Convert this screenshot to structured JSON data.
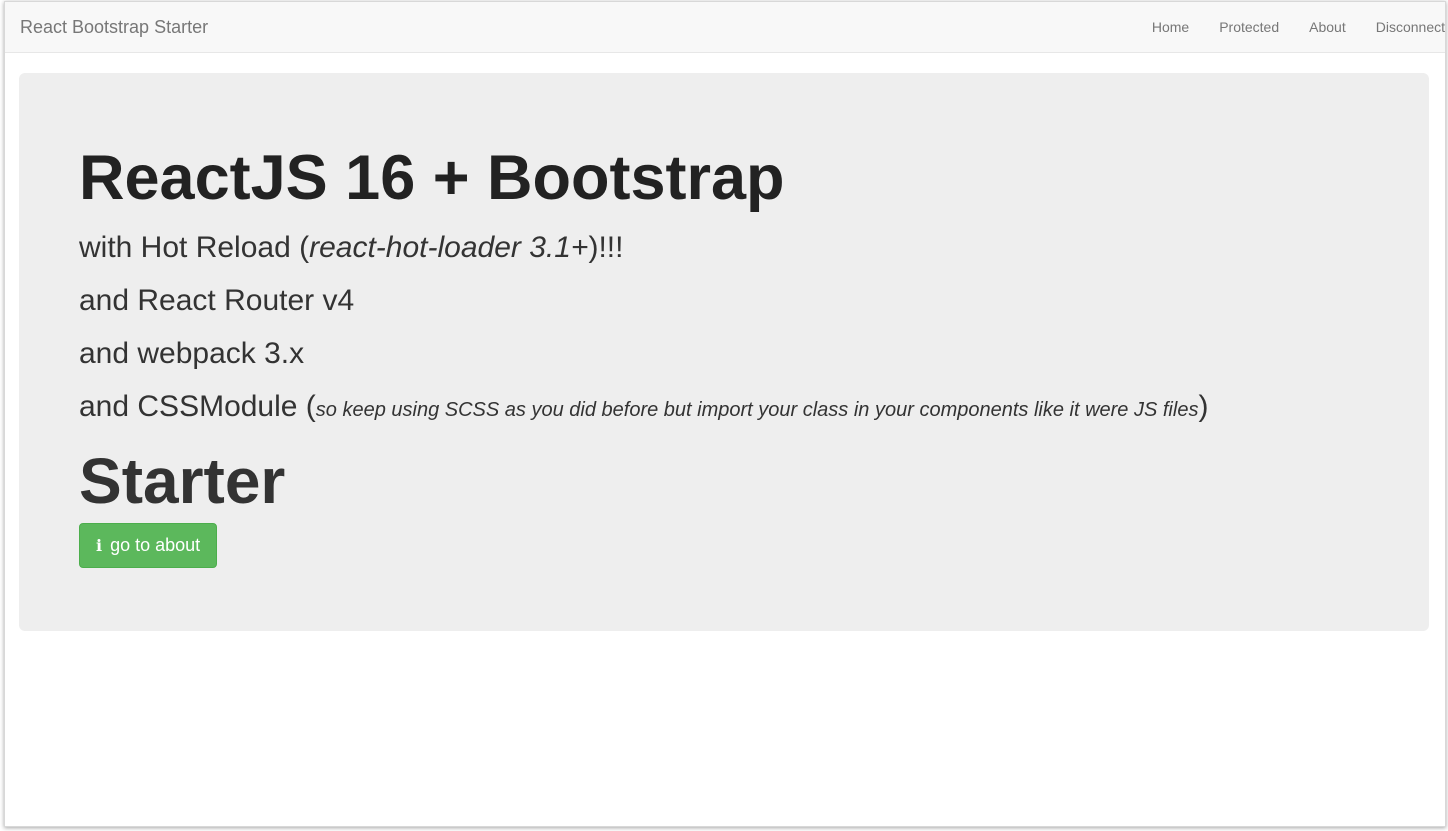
{
  "navbar": {
    "brand": "React Bootstrap Starter",
    "items": [
      {
        "label": "Home"
      },
      {
        "label": "Protected"
      },
      {
        "label": "About"
      },
      {
        "label": "Disconnect"
      }
    ]
  },
  "jumbotron": {
    "title": "ReactJS 16 + Bootstrap",
    "line1": {
      "prefix": "with Hot Reload (",
      "italic": "react-hot-loader 3.1+",
      "suffix": ")!!!"
    },
    "line2": "and React Router v4",
    "line3": "and webpack 3.x",
    "line4": {
      "prefix": "and CSSModule (",
      "note": "so keep using SCSS as you did before but import your class in your components like it were JS files",
      "suffix": ")"
    },
    "subtitle": "Starter",
    "button": {
      "icon": "info-icon",
      "label": "go to about"
    }
  },
  "colors": {
    "navbar_bg": "#f8f8f8",
    "jumbotron_bg": "#eeeeee",
    "button_bg": "#5cb85c",
    "nav_text": "#777777"
  }
}
